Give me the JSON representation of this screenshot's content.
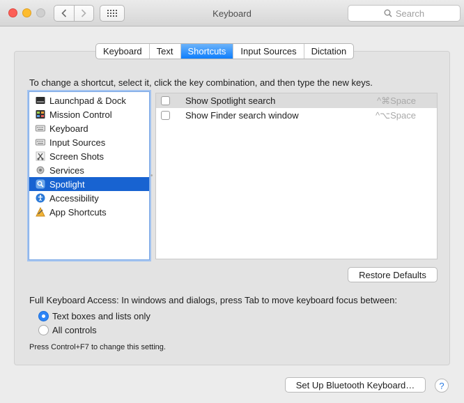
{
  "window": {
    "title": "Keyboard"
  },
  "toolbar": {
    "search_placeholder": "Search"
  },
  "tabs": [
    {
      "label": "Keyboard",
      "active": false
    },
    {
      "label": "Text",
      "active": false
    },
    {
      "label": "Shortcuts",
      "active": true
    },
    {
      "label": "Input Sources",
      "active": false
    },
    {
      "label": "Dictation",
      "active": false
    }
  ],
  "instruction": "To change a shortcut, select it, click the key combination, and then type the new keys.",
  "categories": [
    {
      "label": "Launchpad & Dock",
      "icon": "launchpad-icon"
    },
    {
      "label": "Mission Control",
      "icon": "mission-control-icon"
    },
    {
      "label": "Keyboard",
      "icon": "keyboard-icon"
    },
    {
      "label": "Input Sources",
      "icon": "input-sources-icon"
    },
    {
      "label": "Screen Shots",
      "icon": "screenshot-icon"
    },
    {
      "label": "Services",
      "icon": "gear-icon"
    },
    {
      "label": "Spotlight",
      "icon": "spotlight-icon",
      "selected": true
    },
    {
      "label": "Accessibility",
      "icon": "accessibility-icon"
    },
    {
      "label": "App Shortcuts",
      "icon": "app-shortcuts-icon"
    }
  ],
  "shortcuts": [
    {
      "label": "Show Spotlight search",
      "keys": "^⌘Space",
      "checked": false
    },
    {
      "label": "Show Finder search window",
      "keys": "^⌥Space",
      "checked": false
    }
  ],
  "buttons": {
    "restore": "Restore Defaults",
    "bluetooth": "Set Up Bluetooth Keyboard…",
    "help": "?"
  },
  "full_keyboard_access": {
    "label": "Full Keyboard Access: In windows and dialogs, press Tab to move keyboard focus between:",
    "options": [
      {
        "label": "Text boxes and lists only",
        "selected": true
      },
      {
        "label": "All controls",
        "selected": false
      }
    ],
    "note": "Press Control+F7 to change this setting."
  },
  "colors": {
    "accent": "#1863d1",
    "tab_active": "#0e7efc"
  }
}
